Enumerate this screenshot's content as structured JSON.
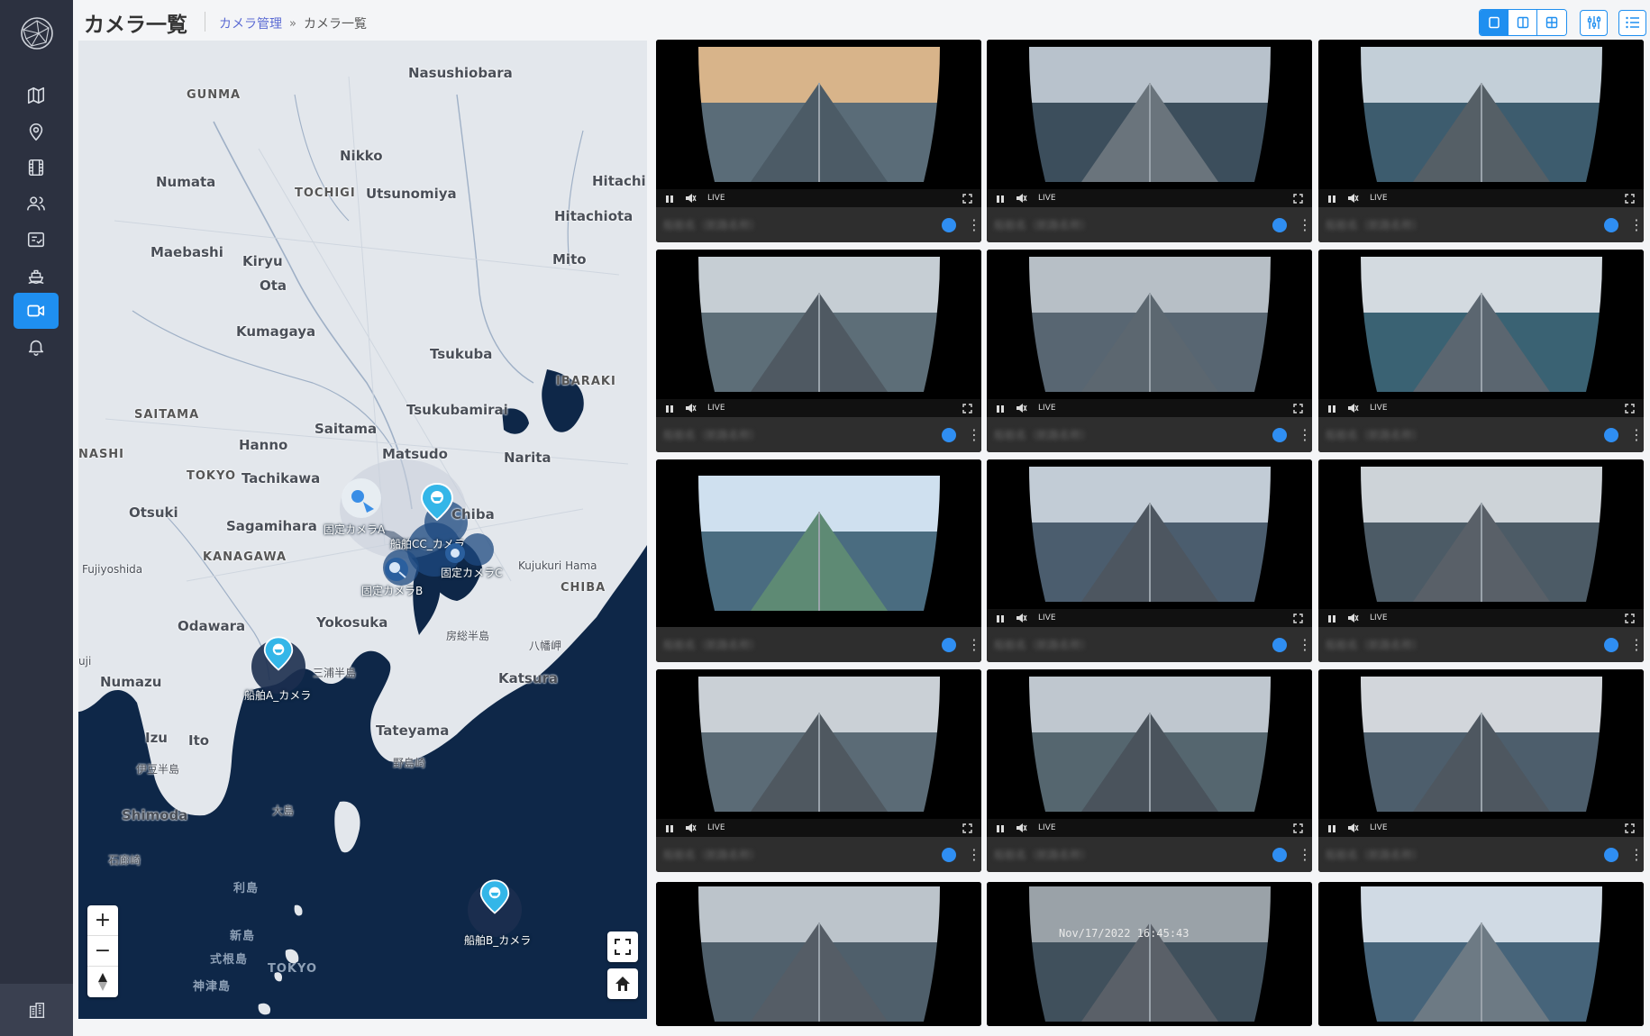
{
  "header": {
    "title": "カメラ一覧",
    "breadcrumb_link": "カメラ管理",
    "breadcrumb_sep": "»",
    "breadcrumb_current": "カメラ一覧"
  },
  "sidebar": {
    "items": [
      {
        "icon": "map-icon"
      },
      {
        "icon": "location-pin-icon"
      },
      {
        "icon": "film-icon"
      },
      {
        "icon": "users-icon"
      },
      {
        "icon": "checklist-icon"
      },
      {
        "icon": "ship-icon"
      },
      {
        "icon": "video-camera-icon",
        "active": true
      },
      {
        "icon": "bell-icon"
      }
    ],
    "bottom_icon": "building-icon"
  },
  "toolbar": {
    "layouts": [
      "single-layout-icon",
      "two-column-layout-icon",
      "grid-layout-icon"
    ],
    "active_layout": 0,
    "buttons": [
      "sliders-icon",
      "list-icon"
    ]
  },
  "map": {
    "labels": [
      {
        "text": "Nasushiobara"
      },
      {
        "text": "GUNMA"
      },
      {
        "text": "Nikko"
      },
      {
        "text": "Numata"
      },
      {
        "text": "TOCHIGI"
      },
      {
        "text": "Utsunomiya"
      },
      {
        "text": "Hitachi"
      },
      {
        "text": "Hitachiota"
      },
      {
        "text": "Maebashi"
      },
      {
        "text": "Kiryu"
      },
      {
        "text": "Mito"
      },
      {
        "text": "Ota"
      },
      {
        "text": "Kumagaya"
      },
      {
        "text": "Tsukuba"
      },
      {
        "text": "IBARAKI"
      },
      {
        "text": "Tsukubamirai"
      },
      {
        "text": "SAITAMA"
      },
      {
        "text": "Saitama"
      },
      {
        "text": "Hanno"
      },
      {
        "text": "NASHI"
      },
      {
        "text": "Matsudo"
      },
      {
        "text": "Narita"
      },
      {
        "text": "TOKYO"
      },
      {
        "text": "Tachikawa"
      },
      {
        "text": "Otsuki"
      },
      {
        "text": "Chiba"
      },
      {
        "text": "Sagamihara"
      },
      {
        "text": "KANAGAWA"
      },
      {
        "text": "Fujiyoshida"
      },
      {
        "text": "Kujukuri Hama"
      },
      {
        "text": "CHIBA"
      },
      {
        "text": "Odawara"
      },
      {
        "text": "Yokosuka"
      },
      {
        "text": "房総半島"
      },
      {
        "text": "八幡岬"
      },
      {
        "text": "三浦半島"
      },
      {
        "text": "Numazu"
      },
      {
        "text": "Katsura"
      },
      {
        "text": "Tateyama"
      },
      {
        "text": "Izu"
      },
      {
        "text": "Ito"
      },
      {
        "text": "野島崎"
      },
      {
        "text": "伊豆半島"
      },
      {
        "text": "Shimoda"
      },
      {
        "text": "大島"
      },
      {
        "text": "石廊崎"
      },
      {
        "text": "利島"
      },
      {
        "text": "新島"
      },
      {
        "text": "式根島"
      },
      {
        "text": "TOKYO"
      },
      {
        "text": "神津島"
      },
      {
        "text": "uji"
      }
    ],
    "cameras": [
      {
        "label": "固定カメラA"
      },
      {
        "label": "船舶CC_カメラ"
      },
      {
        "label": "固定カメラC"
      },
      {
        "label": "固定カメラB"
      },
      {
        "label": "船舶A_カメラ"
      },
      {
        "label": "船舶B_カメラ"
      }
    ],
    "zoom_in": "+",
    "zoom_out": "−"
  },
  "video_cards": [
    {
      "live": "LIVE",
      "name": "船舶名（航路名称）"
    },
    {
      "live": "LIVE",
      "name": "船舶名（航路名称）"
    },
    {
      "live": "LIVE",
      "name": "船舶名（航路名称）"
    },
    {
      "live": "LIVE",
      "name": "船舶名（航路名称）"
    },
    {
      "live": "LIVE",
      "name": "船舶名（航路名称）"
    },
    {
      "live": "LIVE",
      "name": "船舶名（航路名称）"
    },
    {
      "live": "",
      "name": "船舶名（航路名称）"
    },
    {
      "live": "LIVE",
      "name": "船舶名（航路名称）"
    },
    {
      "live": "LIVE",
      "name": "船舶名（航路名称）"
    },
    {
      "live": "LIVE",
      "name": "船舶名（航路名称）"
    },
    {
      "live": "LIVE",
      "name": "船舶名（航路名称）"
    },
    {
      "live": "LIVE",
      "name": "船舶名（航路名称）"
    },
    {
      "live": "",
      "name": ""
    },
    {
      "live": "",
      "name": "",
      "overlay": "Nov/17/2022 16:45:43"
    },
    {
      "live": "",
      "name": ""
    }
  ],
  "colors": {
    "accent": "#1f8ff0",
    "sidebar_bg": "#2c3140",
    "sea": "#0e2748",
    "land": "#e3e7ec"
  }
}
